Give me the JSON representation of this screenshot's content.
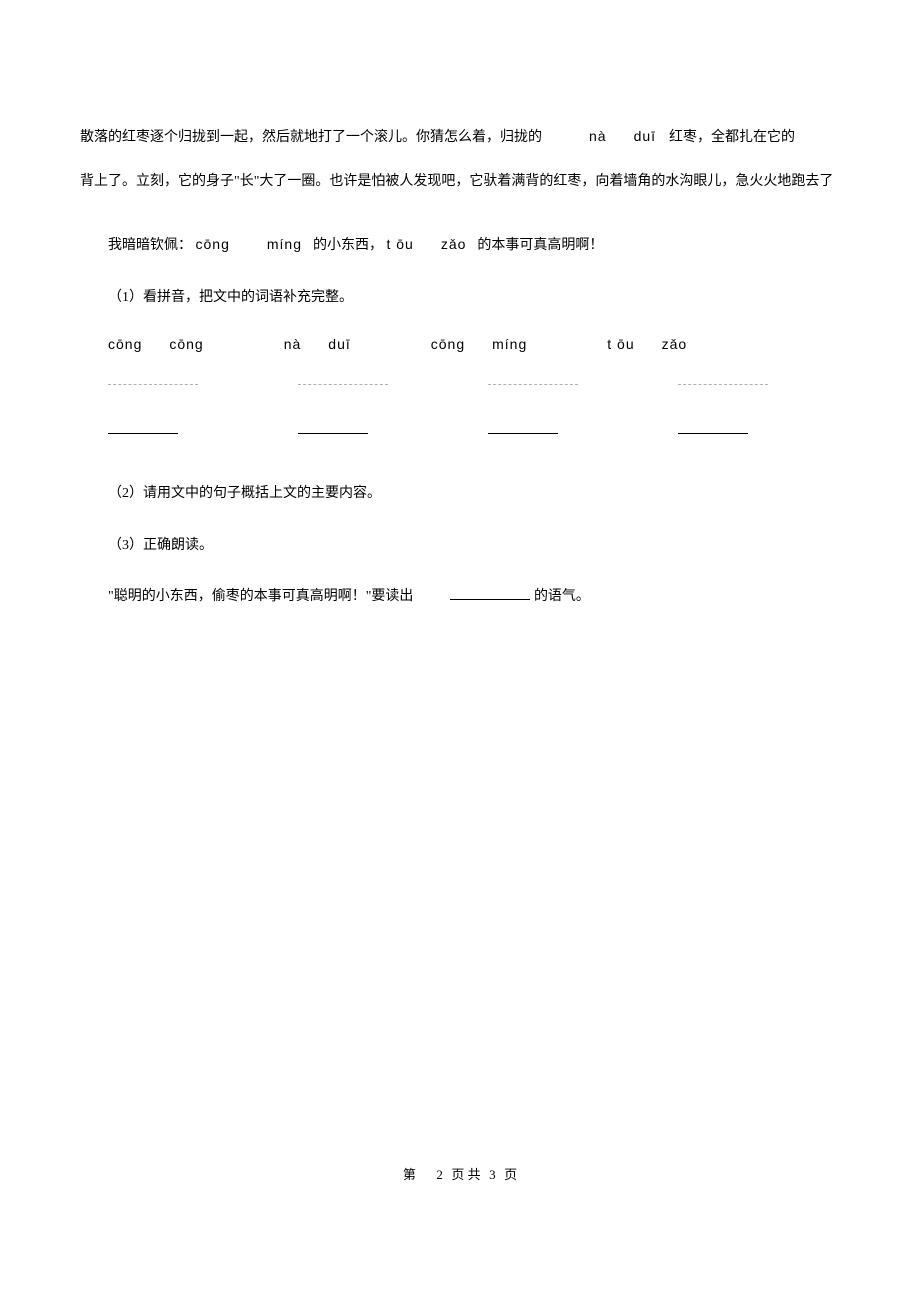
{
  "paras": {
    "p1a": "散落的红枣逐个归拢到一起，然后就地打了一个滚儿。你猜怎么着，归拢的",
    "p1_pinyin1": "nà",
    "p1_pinyin2": "duī",
    "p1b": "红枣，全都扎在它的",
    "p2": "背上了。立刻，它的身子\"长\"大了一圈。也许是怕被人发现吧，它驮着满背的红枣，向着墙角的水沟眼儿，急火火地跑去了",
    "p3a": "我暗暗钦佩：",
    "p3_pinyin1": "cōng",
    "p3_pinyin2": "míng",
    "p3b": "的小东西，",
    "p3_pinyin3": "t ōu",
    "p3_pinyin4": "zǎo",
    "p3c": "的本事可真高明啊！"
  },
  "questions": {
    "q1": "（1）看拼音，把文中的词语补充完整。",
    "q2": "（2）请用文中的句子概括上文的主要内容。",
    "q3": "（3）正确朗读。",
    "q4a": "\"聪明的小东西，偷枣的本事可真高明啊！\"要读出",
    "q4b": "的语气。"
  },
  "pinyin_groups": {
    "g1a": "cōng",
    "g1b": "cōng",
    "g2a": "nà",
    "g2b": "duī",
    "g3a": "cōng",
    "g3b": "míng",
    "g4a": "t ōu",
    "g4b": "zǎo"
  },
  "footer": {
    "prefix": "第",
    "page": "2",
    "middle": "页 共",
    "total": "3",
    "suffix": "页"
  }
}
